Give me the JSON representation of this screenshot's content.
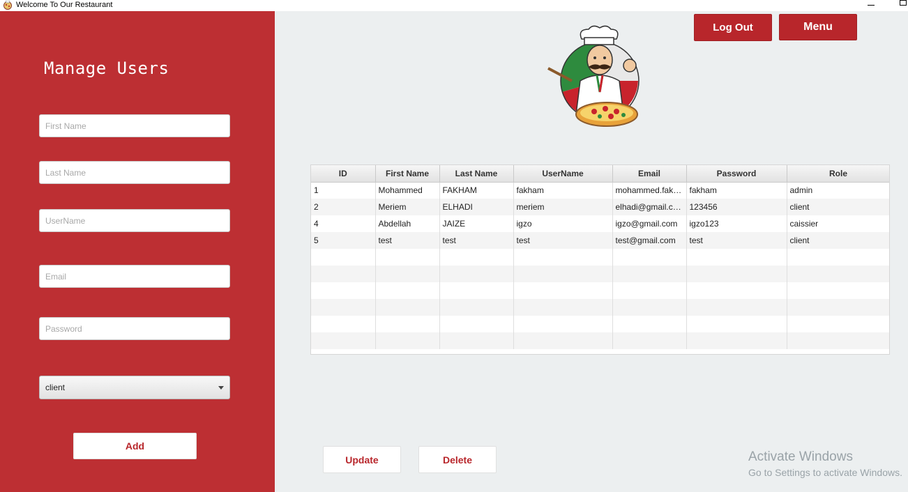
{
  "window": {
    "title": "Welcome To Our Restaurant"
  },
  "sidebar": {
    "title": "Manage Users",
    "fields": {
      "first_name_placeholder": "First Name",
      "last_name_placeholder": "Last Name",
      "username_placeholder": "UserName",
      "email_placeholder": "Email",
      "password_placeholder": "Password"
    },
    "role_select": {
      "value": "client"
    },
    "add_label": "Add"
  },
  "header": {
    "logout_label": "Log Out",
    "menu_label": "Menu"
  },
  "table": {
    "columns": [
      "ID",
      "First Name",
      "Last Name",
      "UserName",
      "Email",
      "Password",
      "Role"
    ],
    "rows": [
      [
        "1",
        "Mohammed",
        "FAKHAM",
        "fakham",
        "mohammed.fakh...",
        "fakham",
        "admin"
      ],
      [
        "2",
        "Meriem",
        "ELHADI",
        "meriem",
        "elhadi@gmail.com",
        "123456",
        "client"
      ],
      [
        "4",
        "Abdellah",
        "JAIZE",
        "igzo",
        "igzo@gmail.com",
        "igzo123",
        "caissier"
      ],
      [
        "5",
        "test",
        "test",
        "test",
        "test@gmail.com",
        "test",
        "client"
      ],
      [
        "",
        "",
        "",
        "",
        "",
        "",
        ""
      ],
      [
        "",
        "",
        "",
        "",
        "",
        "",
        ""
      ],
      [
        "",
        "",
        "",
        "",
        "",
        "",
        ""
      ],
      [
        "",
        "",
        "",
        "",
        "",
        "",
        ""
      ],
      [
        "",
        "",
        "",
        "",
        "",
        "",
        ""
      ],
      [
        "",
        "",
        "",
        "",
        "",
        "",
        ""
      ]
    ]
  },
  "actions": {
    "update_label": "Update",
    "delete_label": "Delete"
  },
  "watermark": {
    "line1": "Activate Windows",
    "line2": "Go to Settings to activate Windows."
  },
  "colors": {
    "sidebar": "#bd2f33",
    "accent": "#b8262b",
    "background": "#eceff0"
  },
  "icons": {
    "app": "pizza-chef-icon",
    "logo": "chef-pizza-logo"
  }
}
